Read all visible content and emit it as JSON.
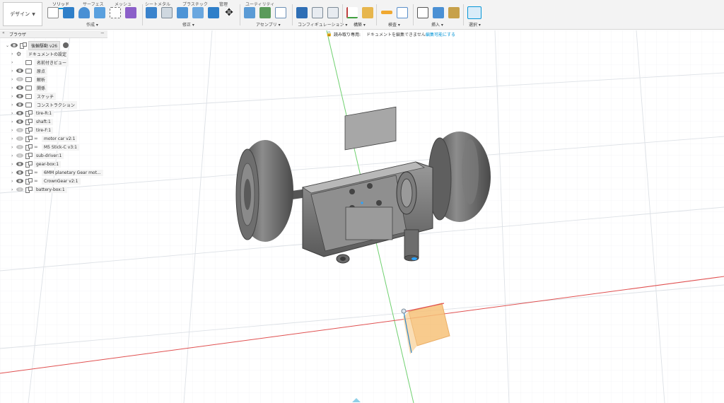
{
  "workspace": {
    "label": "デザイン"
  },
  "tabs": [
    "ソリッド",
    "サーフェス",
    "メッシュ",
    "シートメタル",
    "プラスチック",
    "管理",
    "ユーティリティ"
  ],
  "groups": [
    "作成",
    "修正",
    "アセンブリ",
    "コンフィギュレーション",
    "構築",
    "検査",
    "挿入",
    "選択"
  ],
  "browser": {
    "title": "ブラウザ",
    "root": "後輪駆動 v26",
    "items": [
      "ドキュメントの設定",
      "名前付きビュー",
      "原点",
      "解析",
      "関係",
      "スケッチ",
      "コンストラクション",
      "tire-R:1",
      "shaft:1",
      "tire-F:1",
      "motor car v2:1",
      "M5 Stick-C v3:1",
      "sub-driver:1",
      "gear-box:1",
      "6MM planetary Gear mot...",
      "CrownGear v2:1",
      "battery-box:1"
    ]
  },
  "banner": {
    "prefix": "読み取り専用:",
    "message": "ドキュメントを編集できません",
    "action": "編集可能にする"
  },
  "colors": {
    "accent": "#0696d7",
    "grid": "#e3e6ea",
    "axis_x": "#e05050",
    "axis_y": "#6fd06f",
    "model_body": "#6b6b6b",
    "view_cube_face": "#f7c27a"
  },
  "icons": {
    "lock": "lock-icon",
    "eye": "eye-icon",
    "folder": "folder-icon",
    "gear": "gear-icon",
    "link": "link-icon",
    "component": "component-icon"
  }
}
